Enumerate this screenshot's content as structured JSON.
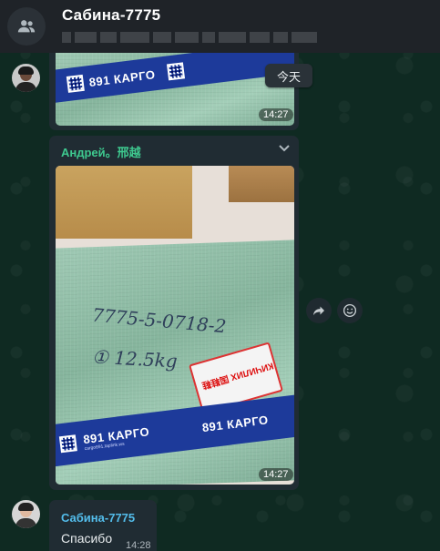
{
  "header": {
    "title": "Сабина-7775"
  },
  "date_separator": "今天",
  "messages": [
    {
      "type": "image",
      "tape_text": "891 КАРГО",
      "time": "14:27"
    },
    {
      "type": "image",
      "sender": "Андрей。邢越",
      "tape_text": "891 КАРГО",
      "tape_subtext": "cargo891.taplink.ws",
      "handwriting_line1": "7775-5-0718-2",
      "handwriting_line2": "① 12.5kg",
      "sticker_text": "КИЧИЛИХ 国鞋鞋",
      "time": "14:27"
    },
    {
      "type": "text",
      "sender": "Сабина-7775",
      "text": "Спасибо",
      "time": "14:28"
    }
  ],
  "icons": {
    "group": "group-icon",
    "forward": "forward-icon",
    "react": "emoji-icon",
    "menu": "chevron-down-icon"
  },
  "colors": {
    "header_bg": "#1f2328",
    "bubble_bg": "#202c33",
    "chat_bg": "#0f2a22",
    "sender_green": "#3ec98f",
    "sender_blue": "#53bdeb",
    "tape_blue": "#1d3a9a"
  }
}
